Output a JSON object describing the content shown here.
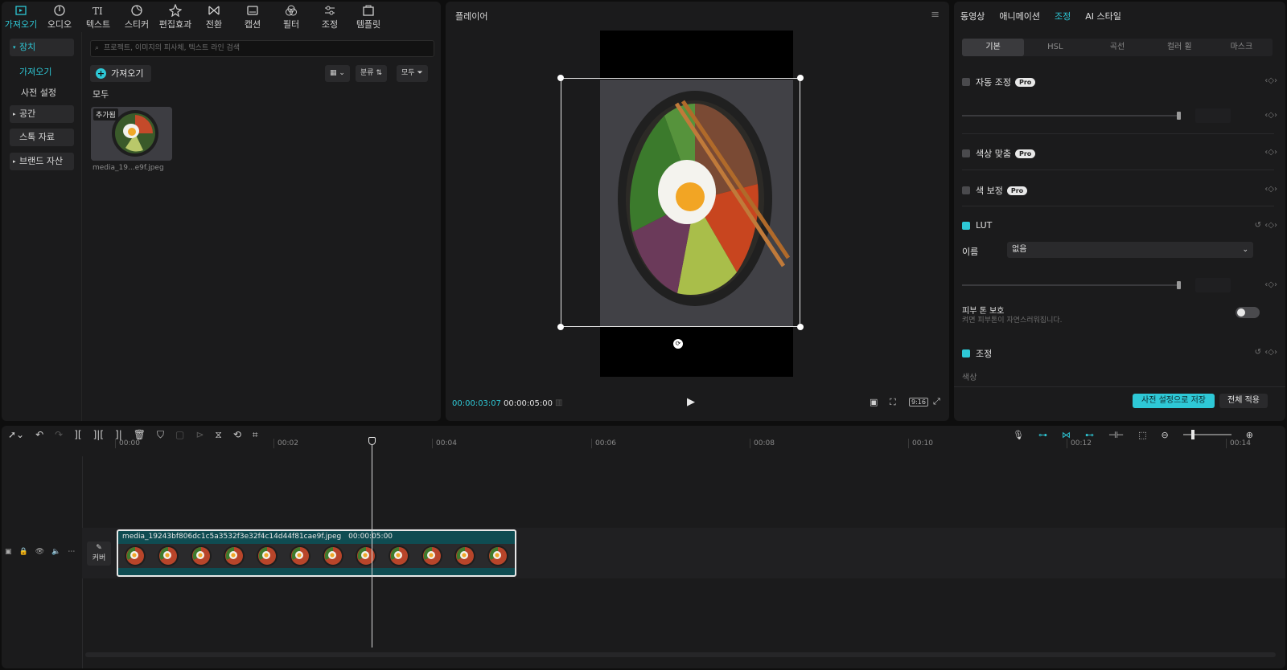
{
  "media_panel": {
    "tools": [
      {
        "label": "가져오기",
        "icon": "import-icon",
        "active": true
      },
      {
        "label": "오디오",
        "icon": "audio-icon"
      },
      {
        "label": "텍스트",
        "icon": "text-icon"
      },
      {
        "label": "스티커",
        "icon": "sticker-icon"
      },
      {
        "label": "편집효과",
        "icon": "effects-icon"
      },
      {
        "label": "전환",
        "icon": "transition-icon"
      },
      {
        "label": "캡션",
        "icon": "caption-icon"
      },
      {
        "label": "필터",
        "icon": "filter-icon"
      },
      {
        "label": "조정",
        "icon": "adjust-icon"
      },
      {
        "label": "템플릿",
        "icon": "template-icon"
      }
    ],
    "sidebar": {
      "device": "장치",
      "import": "가져오기",
      "presets": "사전 설정",
      "space": "공간",
      "stock": "스톡 자료",
      "brand": "브랜드 자산"
    },
    "search_placeholder": "프로젝트, 이미지의 피사체, 텍스트 라인 검색",
    "import_button": "가져오기",
    "sort_label": "분류",
    "filter_label": "모두",
    "section_all": "모두",
    "media_item": {
      "tag": "추가됨",
      "name": "media_19...e9f.jpeg"
    }
  },
  "player": {
    "title": "플레이어",
    "current_time": "00:00:03:07",
    "total_time": "00:00:05:00",
    "ratio": "9:16"
  },
  "props": {
    "tabs": [
      "동영상",
      "애니메이션",
      "조정",
      "AI 스타일"
    ],
    "active_tab": "조정",
    "subtabs": [
      "기본",
      "HSL",
      "곡선",
      "컬러 휠",
      "마스크"
    ],
    "auto_adjust": "자동 조정",
    "color_match": "색상 맞춤",
    "color_correct": "색 보정",
    "pro_badge": "Pro",
    "lut": "LUT",
    "name_label": "이름",
    "name_value": "없음",
    "skin_protect": "피부 톤 보호",
    "skin_desc": "켜면 피부톤이 자연스러워집니다.",
    "adjust": "조정",
    "hue_label": "색상",
    "save_preset": "사전 설정으로 저장",
    "apply_all": "전체 적용"
  },
  "timeline": {
    "ticks": [
      "00:00",
      "00:02",
      "00:04",
      "00:06",
      "00:08",
      "00:10",
      "00:12",
      "00:14"
    ],
    "clip_name": "media_19243bf806dc1c5a3532f3e32f4c14d44f81cae9f.jpeg",
    "clip_duration": "00:00:05:00",
    "cover_label": "커버"
  }
}
